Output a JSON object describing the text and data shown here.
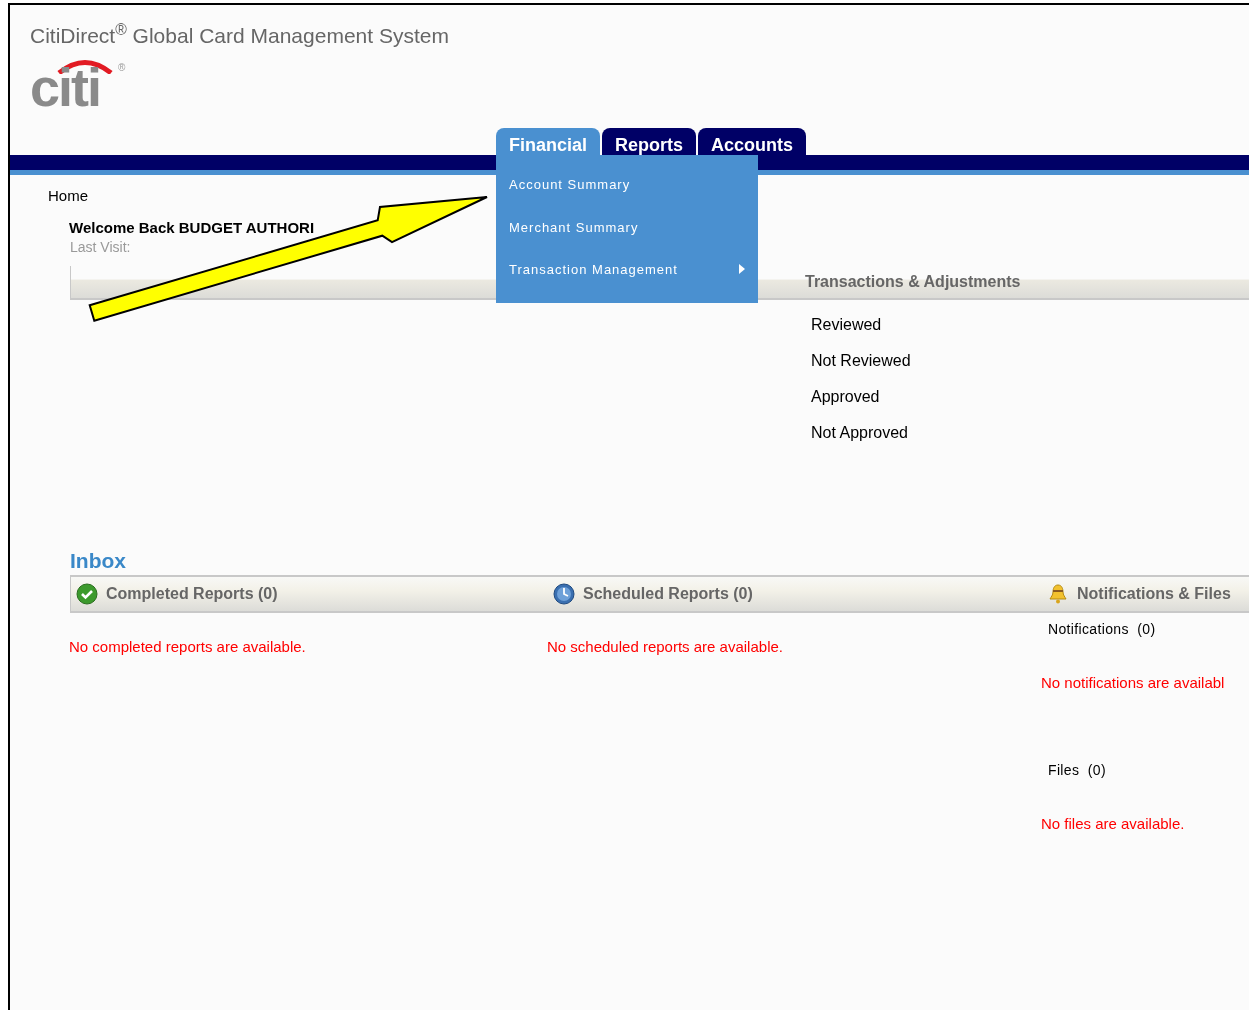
{
  "app_title": "CitiDirect$^{®}$ Global Card Management System",
  "logo": {
    "text": "citi",
    "mark": "®"
  },
  "tabs": [
    {
      "label": "Financial",
      "selected": true
    },
    {
      "label": "Reports",
      "selected": false
    },
    {
      "label": "Accounts",
      "selected": false
    }
  ],
  "menu": [
    {
      "label": "Account Summary",
      "submenu": false
    },
    {
      "label": "Merchant Summary",
      "submenu": false
    },
    {
      "label": "Transaction Management",
      "submenu": true
    }
  ],
  "breadcrumb": "Home",
  "welcome": "Welcome Back BUDGET AUTHORI",
  "last_visit": "Last Visit:",
  "transactions": {
    "title": "Transactions & Adjustments",
    "items": [
      "Reviewed",
      "Not Reviewed",
      "Approved",
      "Not Approved"
    ]
  },
  "inbox": {
    "title": "Inbox",
    "sections": [
      {
        "kind": "completed",
        "title": "Completed Reports (0)",
        "groups": [
          {
            "message": "No completed reports are available."
          }
        ]
      },
      {
        "kind": "scheduled",
        "title": "Scheduled Reports (0)",
        "groups": [
          {
            "message": "No scheduled reports are available."
          }
        ]
      },
      {
        "kind": "notifications",
        "title": "Notifications & Files",
        "groups": [
          {
            "label": "Notifications  (0)",
            "message": "No notifications are availabl"
          },
          {
            "label": "Files  (0)",
            "message": "No files are available."
          }
        ]
      }
    ]
  }
}
